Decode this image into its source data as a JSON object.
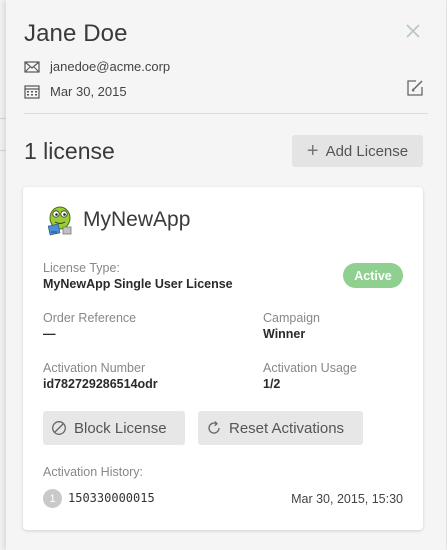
{
  "user": {
    "name": "Jane Doe",
    "email": "janedoe@acme.corp",
    "date": "Mar 30, 2015",
    "close_icon": "close-icon",
    "edit_icon": "edit-icon"
  },
  "licenses": {
    "count_label": "1 license",
    "add_button_label": "Add License"
  },
  "license_card": {
    "app_name": "MyNewApp",
    "license_type_label": "License Type:",
    "license_type_value": "MyNewApp Single User License",
    "status": "Active",
    "status_color": "#8fcf8f",
    "order_reference_label": "Order Reference",
    "order_reference_value": "—",
    "campaign_label": "Campaign",
    "campaign_value": "Winner",
    "activation_number_label": "Activation Number",
    "activation_number_value": "id782729286514odr",
    "activation_usage_label": "Activation Usage",
    "activation_usage_value": "1/2",
    "block_button_label": "Block License",
    "reset_button_label": "Reset Activations",
    "history_label": "Activation History:",
    "history": [
      {
        "index": "1",
        "id": "150330000015",
        "date": "Mar 30, 2015, 15:30"
      }
    ]
  }
}
